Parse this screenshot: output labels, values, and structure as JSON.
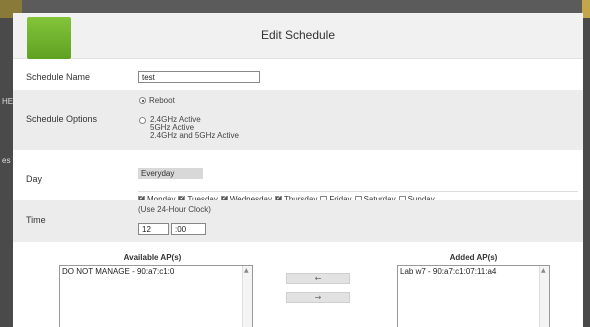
{
  "background": {
    "left_fragments": [
      "HE",
      "es"
    ]
  },
  "modal": {
    "title": "Edit Schedule"
  },
  "schedule_name": {
    "label": "Schedule Name",
    "value": "test"
  },
  "schedule_options": {
    "label": "Schedule Options",
    "reboot": "Reboot",
    "active_lines": [
      "2.4GHz Active",
      "5GHz Active",
      "2.4GHz and 5GHz Active"
    ]
  },
  "day": {
    "label": "Day",
    "everyday": "Everyday",
    "days": [
      {
        "label": "Monday",
        "checked": true
      },
      {
        "label": "Tuesday",
        "checked": true
      },
      {
        "label": "Wednesday",
        "checked": true
      },
      {
        "label": "Thursday",
        "checked": true
      },
      {
        "label": "Friday",
        "checked": false
      },
      {
        "label": "Saturday",
        "checked": false
      },
      {
        "label": "Sunday",
        "checked": false
      }
    ]
  },
  "time": {
    "label": "Time",
    "hint": "(Use 24-Hour Clock)",
    "hour": "12",
    "minute": ":00"
  },
  "aps": {
    "available_title": "Available AP(s)",
    "available_items": [
      "DO NOT MANAGE - 90:a7:c1:0"
    ],
    "added_title": "Added AP(s)",
    "added_items": [
      "Lab w7 - 90:a7:c1:07:11:a4"
    ],
    "remove_button": "←",
    "add_button": "→"
  },
  "colors": {
    "brand_green": "#6db12b",
    "row_grey": "#ececec"
  }
}
